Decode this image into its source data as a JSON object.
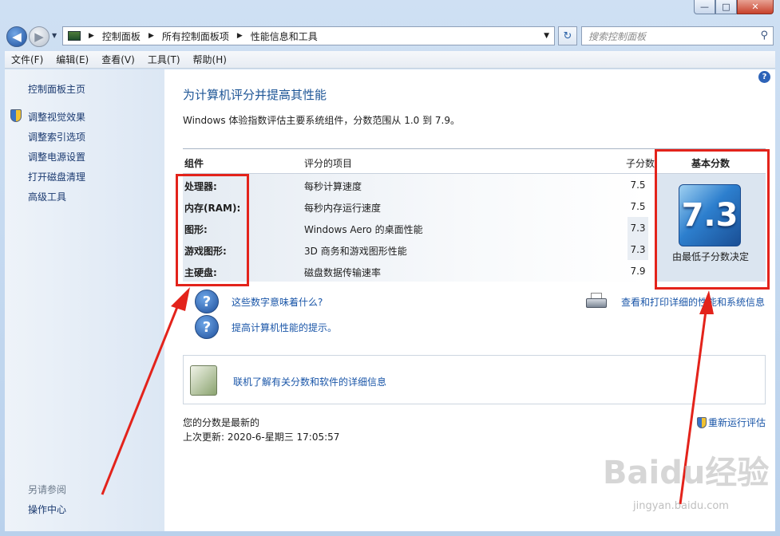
{
  "window": {
    "minimize": "—",
    "maximize": "□",
    "close": "✕"
  },
  "nav": {
    "back_icon": "◀",
    "forward_icon": "▶",
    "breadcrumbs": [
      "控制面板",
      "所有控制面板项",
      "性能信息和工具"
    ],
    "separator": "▶",
    "search_placeholder": "搜索控制面板"
  },
  "menu": [
    "文件(F)",
    "编辑(E)",
    "查看(V)",
    "工具(T)",
    "帮助(H)"
  ],
  "sidebar": {
    "items": [
      "控制面板主页",
      "调整视觉效果",
      "调整索引选项",
      "调整电源设置",
      "打开磁盘清理",
      "高级工具"
    ],
    "see_also_title": "另请参阅",
    "see_also_items": [
      "操作中心"
    ]
  },
  "main": {
    "title": "为计算机评分并提高其性能",
    "description": "Windows 体验指数评估主要系统组件，分数范围从 1.0 到 7.9。",
    "table": {
      "headers": {
        "component": "组件",
        "item": "评分的项目",
        "subscore": "子分数",
        "base": "基本分数"
      },
      "rows": [
        {
          "component": "处理器:",
          "item": "每秒计算速度",
          "subscore": "7.5"
        },
        {
          "component": "内存(RAM):",
          "item": "每秒内存运行速度",
          "subscore": "7.5"
        },
        {
          "component": "图形:",
          "item": "Windows Aero 的桌面性能",
          "subscore": "7.3"
        },
        {
          "component": "游戏图形:",
          "item": "3D 商务和游戏图形性能",
          "subscore": "7.3"
        },
        {
          "component": "主硬盘:",
          "item": "磁盘数据传输速率",
          "subscore": "7.9"
        }
      ],
      "base_score": "7.3",
      "base_note": "由最低子分数决定"
    },
    "links": {
      "what_numbers_mean": "这些数字意味着什么?",
      "tips": "提高计算机性能的提示。",
      "print_details": "查看和打印详细的性能和系统信息",
      "learn_more": "联机了解有关分数和软件的详细信息"
    },
    "status": {
      "up_to_date": "您的分数是最新的",
      "last_update": "上次更新: 2020-6-星期三 17:05:57",
      "rerun": "重新运行评估"
    }
  },
  "watermark": {
    "brand": "Baidu经验",
    "url": "jingyan.baidu.com"
  },
  "colors": {
    "annotation": "#e3231b",
    "link": "#1a56a8",
    "title": "#1d5596"
  }
}
